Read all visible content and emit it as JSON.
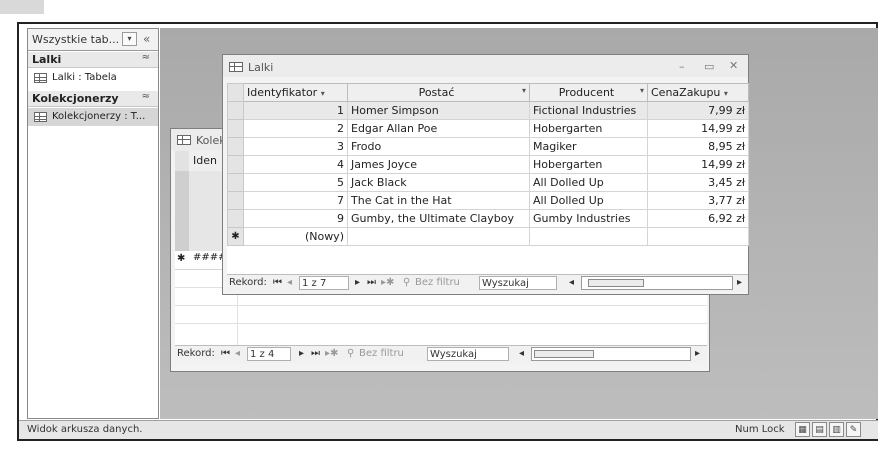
{
  "nav": {
    "title": "Wszystkie tab...",
    "dropdown_glyph": "▾",
    "collapse_glyph": "«",
    "groups": [
      {
        "label": "Lalki",
        "chevron": "≈",
        "items": [
          {
            "label": "Lalki : Tabela"
          }
        ]
      },
      {
        "label": "Kolekcjonerzy",
        "chevron": "≈",
        "items": [
          {
            "label": "Kolekcjonerzy : T..."
          }
        ]
      }
    ]
  },
  "back_window": {
    "title": "Kolek",
    "header_col": "Iden",
    "new_row_marker": "✱",
    "new_row_value": "####",
    "record_label": "Rekord:",
    "record_position": "1 z 4",
    "filter_label": "Bez filtru",
    "search_label": "Wyszukaj"
  },
  "front_window": {
    "title": "Lalki",
    "columns": [
      "Identyfikator",
      "Postać",
      "Producent",
      "CenaZakupu"
    ],
    "rows": [
      {
        "id": "1",
        "postac": "Homer Simpson",
        "producent": "Fictional Industries",
        "cena": "7,99 zł"
      },
      {
        "id": "2",
        "postac": "Edgar Allan Poe",
        "producent": "Hobergarten",
        "cena": "14,99 zł"
      },
      {
        "id": "3",
        "postac": "Frodo",
        "producent": "Magiker",
        "cena": "8,95 zł"
      },
      {
        "id": "4",
        "postac": "James Joyce",
        "producent": "Hobergarten",
        "cena": "14,99 zł"
      },
      {
        "id": "5",
        "postac": "Jack Black",
        "producent": "All Dolled Up",
        "cena": "3,45 zł"
      },
      {
        "id": "7",
        "postac": "The Cat in the Hat",
        "producent": "All Dolled Up",
        "cena": "3,77 zł"
      },
      {
        "id": "9",
        "postac": "Gumby, the Ultimate Clayboy",
        "producent": "Gumby Industries",
        "cena": "6,92 zł"
      }
    ],
    "new_row_marker": "✱",
    "new_row_label": "(Nowy)",
    "record_label": "Rekord:",
    "record_position": "1 z 7",
    "filter_label": "Bez filtru",
    "search_label": "Wyszukaj"
  },
  "status": {
    "text": "Widok arkusza danych.",
    "numlock": "Num Lock"
  },
  "colors": {
    "workspace": "#b4b4b4",
    "window_bg": "#f3f3f3",
    "header_bg": "#efefef"
  }
}
